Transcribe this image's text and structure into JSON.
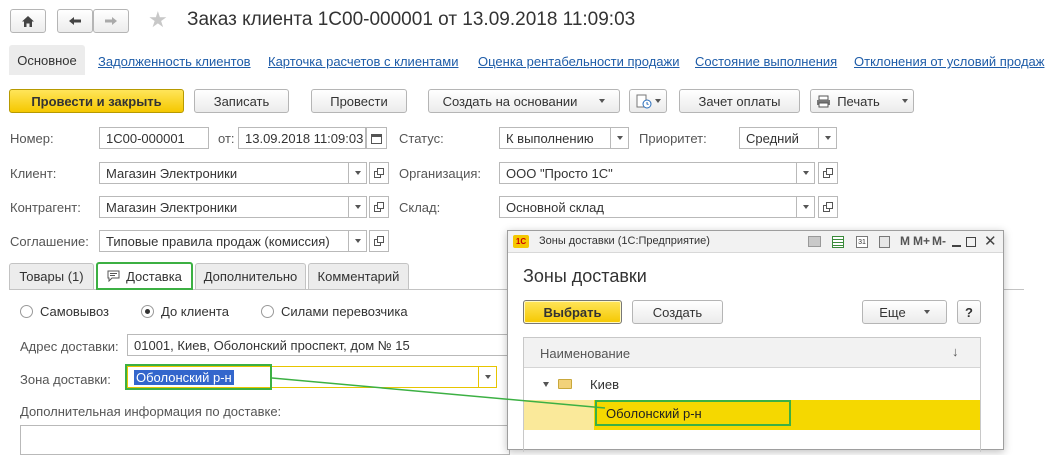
{
  "header": {
    "title": "Заказ клиента 1С00-000001 от 13.09.2018 11:09:03"
  },
  "tabs": {
    "main": "Основное",
    "links": [
      "Задолженность клиентов",
      "Карточка расчетов с клиентами",
      "Оценка рентабельности продажи",
      "Состояние выполнения",
      "Отклонения от условий продаж"
    ]
  },
  "toolbar": {
    "post_close": "Провести и закрыть",
    "save": "Записать",
    "post": "Провести",
    "create_based": "Создать на основании",
    "offset": "Зачет оплаты",
    "print": "Печать"
  },
  "form": {
    "number_label": "Номер:",
    "number": "1С00-000001",
    "from_label": "от:",
    "date": "13.09.2018 11:09:03",
    "status_label": "Статус:",
    "status": "К выполнению",
    "priority_label": "Приоритет:",
    "priority": "Средний",
    "client_label": "Клиент:",
    "client": "Магазин Электроники",
    "org_label": "Организация:",
    "org": "ООО \"Просто 1С\"",
    "counterparty_label": "Контрагент:",
    "counterparty": "Магазин Электроники",
    "warehouse_label": "Склад:",
    "warehouse": "Основной склад",
    "agreement_label": "Соглашение:",
    "agreement": "Типовые правила продаж (комиссия)"
  },
  "subtabs": {
    "goods": "Товары (1)",
    "delivery": "Доставка",
    "additional": "Дополнительно",
    "comment": "Комментарий"
  },
  "delivery": {
    "pickup": "Самовывоз",
    "to_client": "До клиента",
    "carrier": "Силами перевозчика",
    "address_label": "Адрес доставки:",
    "address": "01001, Киев, Оболонский проспект, дом № 15",
    "zone_label": "Зона доставки:",
    "zone": "Оболонский р-н",
    "extra_label": "Дополнительная информация по доставке:"
  },
  "dialog": {
    "window_title": "Зоны доставки  (1С:Предприятие)",
    "heading": "Зоны доставки",
    "select": "Выбрать",
    "create": "Создать",
    "more": "Еще",
    "help": "?",
    "col_name": "Наименование",
    "sort_indicator": "↓",
    "group": "Киев",
    "item": "Оболонский р-н",
    "win_m": "M",
    "win_mplus": "M+",
    "win_mminus": "M-"
  },
  "colors": {
    "accent_yellow": "#f5c800",
    "highlight_green": "#3cb043",
    "link_blue": "#1e5ca8",
    "selection_blue": "#3366cc"
  }
}
